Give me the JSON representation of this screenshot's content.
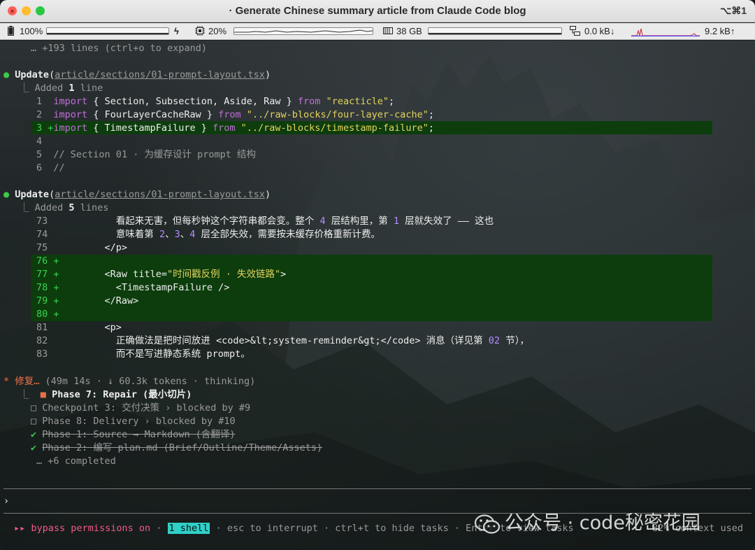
{
  "window": {
    "title": "Generate Chinese summary article from Claude Code blog",
    "shortcut": "⌥⌘1"
  },
  "status": {
    "battery": "100%",
    "cpu": "20%",
    "memory": "38 GB",
    "net_down": "0.0 kB↓",
    "net_up": "9.2 kB↑"
  },
  "terminal": {
    "collapsed": "… +193 lines (ctrl+o to expand)",
    "update1": {
      "label": "Update",
      "path": "article/sections/01-prompt-layout.tsx",
      "summary_prefix": "Added ",
      "summary_count": "1",
      "summary_suffix": " line",
      "lines": [
        {
          "n": "1",
          "kw": "import",
          "mid": " { Section, Subsection, Aside, Raw } ",
          "from": "from",
          "str": "\"reacticle\"",
          "end": ";"
        },
        {
          "n": "2",
          "kw": "import",
          "mid": " { FourLayerCacheRaw } ",
          "from": "from",
          "str": "\"../raw-blocks/four-layer-cache\"",
          "end": ";"
        },
        {
          "n": "3 +",
          "kw": "import",
          "mid": " { TimestampFailure } ",
          "from": "from",
          "str": "\"../raw-blocks/timestamp-failure\"",
          "end": ";"
        },
        {
          "n": "4",
          "text": ""
        },
        {
          "n": "5",
          "text": "// Section 01 · 为缓存设计 prompt 结构"
        },
        {
          "n": "6",
          "text": "//"
        }
      ]
    },
    "update2": {
      "label": "Update",
      "path": "article/sections/01-prompt-layout.tsx",
      "summary_prefix": "Added ",
      "summary_count": "5",
      "summary_suffix": " lines",
      "l73_a": "看起来无害，但每秒钟这个字符串都会变。整个 ",
      "l73_n1": "4",
      "l73_b": " 层结构里，第 ",
      "l73_n2": "1",
      "l73_c": " 层就失效了 —— 这也",
      "l74_a": "意味着第 ",
      "l74_n1": "2",
      "l74_b": "、",
      "l74_n2": "3",
      "l74_c": "、",
      "l74_n3": "4",
      "l74_d": " 层全部失效，需要按未缓存价格重新计费。",
      "l75": "</p>",
      "l77_a": "<Raw title=",
      "l77_str": "\"时间戳反例 · 失效链路\"",
      "l77_b": ">",
      "l78": "<TimestampFailure />",
      "l79": "</Raw>",
      "l81": "<p>",
      "l82_a": "正确做法是把时间放进 <code>&lt;system-reminder&gt;</code> 消息（详见第 ",
      "l82_n": "02",
      "l82_b": " 节），",
      "l83": "而不是写进静态系统 prompt。",
      "nums": [
        "73",
        "74",
        "75",
        "76 +",
        "77 +",
        "78 +",
        "79 +",
        "80 +",
        "81",
        "82",
        "83"
      ]
    },
    "thinking": {
      "star": "*",
      "label": "修复…",
      "meta": " (49m 14s · ↓ 60.3k tokens · thinking)"
    },
    "tasks": [
      {
        "mark": "■",
        "text": "Phase 7: Repair (最小切片)"
      },
      {
        "mark": "□",
        "text": "Checkpoint 3: 交付决策 › blocked by #9"
      },
      {
        "mark": "□",
        "text": "Phase 8: Delivery › blocked by #10"
      },
      {
        "mark": "✔",
        "text": "Phase 1: Source → Markdown (含翻译)"
      },
      {
        "mark": "✔",
        "text": "Phase 2: 编写 plan.md (Brief/Outline/Theme/Assets)"
      }
    ],
    "completed_more": "… +6 completed",
    "prompt_char": "›",
    "footer": {
      "arrows": "▸▸",
      "bypass": "bypass permissions on",
      "shell": "1 shell",
      "hint1": "· esc to interrupt · ctrl+t to hide tasks · Enter to view tasks",
      "context": "82% context used"
    }
  },
  "watermark": "公众号 · code秘密花园",
  "colors": {
    "accent_green": "#3ec94a",
    "diff_bg": "#0d3d0d",
    "keyword": "#c16fd9",
    "string": "#e3d35e",
    "number": "#b38cff",
    "bypass": "#f25a8a"
  }
}
